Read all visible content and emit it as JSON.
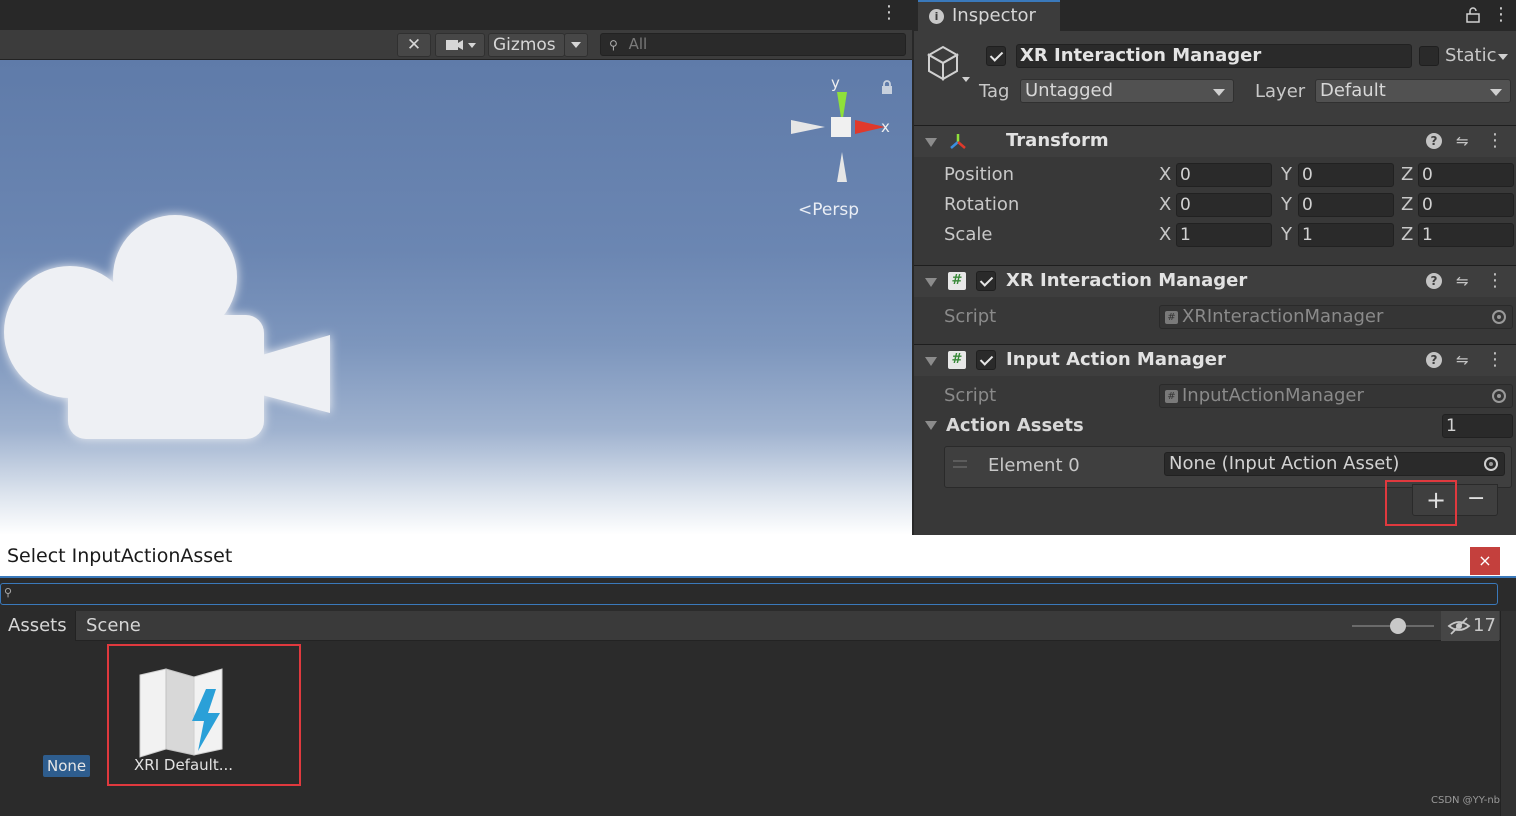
{
  "scene": {
    "toolbar": {
      "gizmos_label": "Gizmos",
      "search_placeholder": "All"
    },
    "gizmo": {
      "y_label": "y",
      "x_label": "x",
      "projection_label": "Persp"
    }
  },
  "inspector": {
    "tab_label": "Inspector",
    "object": {
      "name": "XR Interaction Manager",
      "static_label": "Static",
      "tag_label": "Tag",
      "tag_value": "Untagged",
      "layer_label": "Layer",
      "layer_value": "Default"
    },
    "transform": {
      "title": "Transform",
      "rows": [
        {
          "label": "Position",
          "x": "0",
          "y": "0",
          "z": "0"
        },
        {
          "label": "Rotation",
          "x": "0",
          "y": "0",
          "z": "0"
        },
        {
          "label": "Scale",
          "x": "1",
          "y": "1",
          "z": "1"
        }
      ],
      "axis_x": "X",
      "axis_y": "Y",
      "axis_z": "Z"
    },
    "xr_manager": {
      "title": "XR Interaction Manager",
      "script_label": "Script",
      "script_value": "XRInteractionManager"
    },
    "input_manager": {
      "title": "Input Action Manager",
      "script_label": "Script",
      "script_value": "InputActionManager",
      "action_assets_label": "Action Assets",
      "action_assets_count": "1",
      "element_label": "Element 0",
      "element_value": "None (Input Action Asset)",
      "add_label": "+",
      "remove_label": "−"
    }
  },
  "dialog": {
    "title": "Select InputActionAsset",
    "close_label": "×",
    "tabs": [
      "Assets",
      "Scene"
    ],
    "hidden_count": "17",
    "items": [
      {
        "label": "None"
      },
      {
        "label": "XRI Default..."
      }
    ]
  },
  "watermark": "CSDN @YY-nb",
  "colors": {
    "accent": "#3a79bb",
    "highlight_box": "#e0393e",
    "gizmo_y": "#8fe03a",
    "gizmo_x": "#e0392b",
    "asset_icon_bolt": "#2aa0d8"
  }
}
